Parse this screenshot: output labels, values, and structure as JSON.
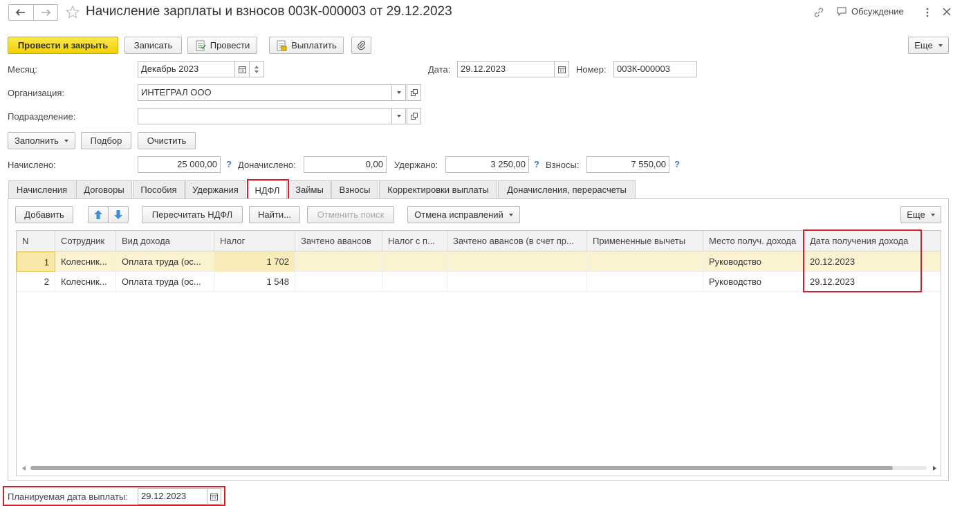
{
  "window": {
    "title": "Начисление зарплаты и взносов 003К-000003 от 29.12.2023",
    "discussion": "Обсуждение"
  },
  "toolbar": {
    "post_close": "Провести и закрыть",
    "save": "Записать",
    "post": "Провести",
    "pay": "Выплатить",
    "more": "Еще"
  },
  "fields": {
    "month_label": "Месяц:",
    "month_value": "Декабрь 2023",
    "date_label": "Дата:",
    "date_value": "29.12.2023",
    "number_label": "Номер:",
    "number_value": "003К-000003",
    "org_label": "Организация:",
    "org_value": "ИНТЕГРАЛ ООО",
    "dept_label": "Подразделение:",
    "dept_value": ""
  },
  "actions": {
    "fill": "Заполнить",
    "select": "Подбор",
    "clear": "Очистить"
  },
  "totals": {
    "accrued_label": "Начислено:",
    "accrued_value": "25 000,00",
    "extra_label": "Доначислено:",
    "extra_value": "0,00",
    "withheld_label": "Удержано:",
    "withheld_value": "3 250,00",
    "contrib_label": "Взносы:",
    "contrib_value": "7 550,00",
    "help": "?"
  },
  "tabs": [
    {
      "label": "Начисления"
    },
    {
      "label": "Договоры"
    },
    {
      "label": "Пособия"
    },
    {
      "label": "Удержания"
    },
    {
      "label": "НДФЛ"
    },
    {
      "label": "Займы"
    },
    {
      "label": "Взносы"
    },
    {
      "label": "Корректировки выплаты"
    },
    {
      "label": "Доначисления, перерасчеты"
    }
  ],
  "ndfl_toolbar": {
    "add": "Добавить",
    "recalc": "Пересчитать НДФЛ",
    "find": "Найти...",
    "cancel_search": "Отменить поиск",
    "cancel_corrections": "Отмена исправлений",
    "more": "Еще"
  },
  "table": {
    "columns": [
      "N",
      "Сотрудник",
      "Вид дохода",
      "Налог",
      "Зачтено авансов",
      "Налог с п...",
      "Зачтено авансов (в счет пр...",
      "Примененные вычеты",
      "Место получ. дохода",
      "Дата получения дохода"
    ],
    "rows": [
      {
        "n": "1",
        "employee": "Колесник...",
        "income_type": "Оплата труда (ос...",
        "tax": "1 702",
        "advances": "",
        "tax_p": "",
        "advances_acc": "",
        "deductions": "",
        "place": "Руководство",
        "date": "20.12.2023"
      },
      {
        "n": "2",
        "employee": "Колесник...",
        "income_type": "Оплата труда (ос...",
        "tax": "1 548",
        "advances": "",
        "tax_p": "",
        "advances_acc": "",
        "deductions": "",
        "place": "Руководство",
        "date": "29.12.2023"
      }
    ]
  },
  "footer": {
    "planned_label": "Планируемая дата выплаты:",
    "planned_value": "29.12.2023"
  },
  "colors": {
    "primary_button": "#f2cf08",
    "highlight": "#d0212a",
    "selected_row": "#fbf3d0",
    "help": "#2f7fc8"
  }
}
